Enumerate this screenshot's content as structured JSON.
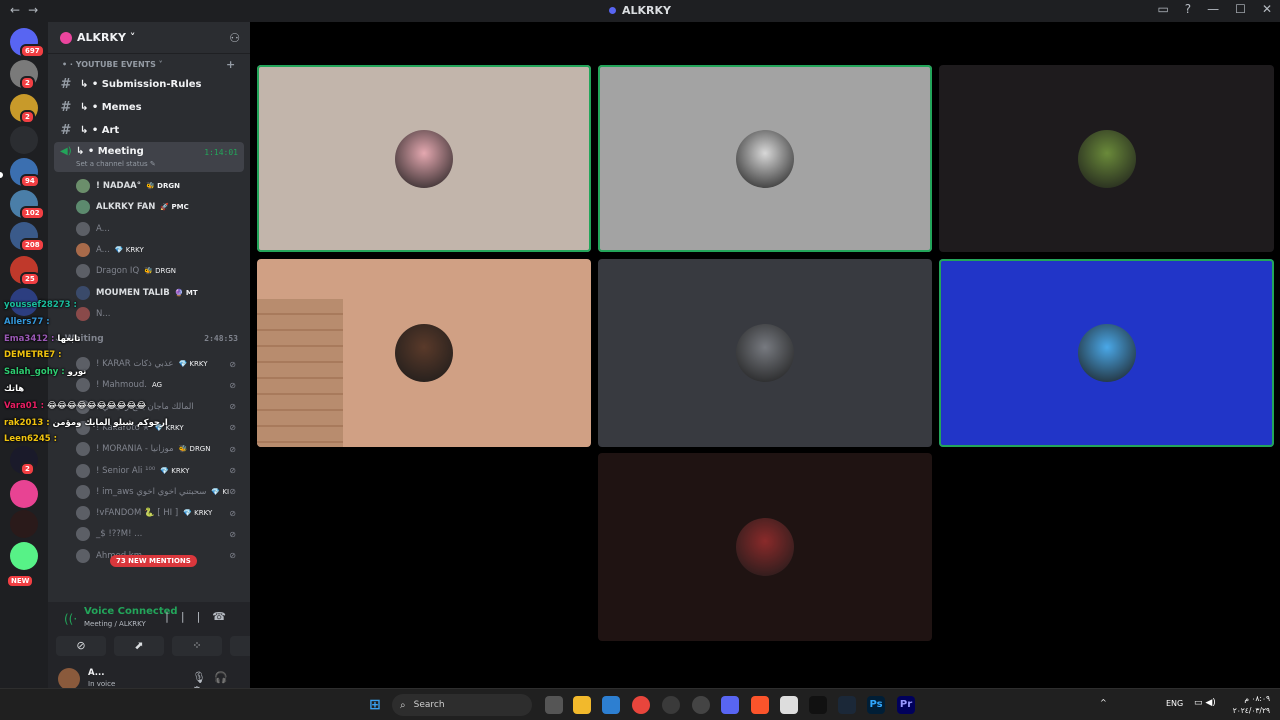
{
  "window": {
    "title": "ALKRKY",
    "nav_back": "←",
    "nav_fwd": "→",
    "controls": [
      "▭",
      "?",
      "—",
      "☐",
      "✕"
    ]
  },
  "guilds": [
    {
      "name": "discord-home-icon",
      "badge": "697",
      "color": "#5865f2"
    },
    {
      "name": "server-1",
      "badge": "2",
      "color": "#7a7a7a"
    },
    {
      "name": "server-2",
      "badge": "2",
      "color": "#c89a2a"
    },
    {
      "name": "server-cloud",
      "badge": "",
      "color": "#2b2d31"
    },
    {
      "name": "server-3",
      "badge": "94",
      "color": "#3b6fb0"
    },
    {
      "name": "server-4",
      "badge": "102",
      "color": "#4a7ea8"
    },
    {
      "name": "server-5",
      "badge": "208",
      "color": "#3a5a8a"
    },
    {
      "name": "server-6",
      "badge": "25",
      "color": "#c0392b"
    },
    {
      "name": "server-7",
      "badge": "",
      "color": "#2c3e80"
    },
    {
      "name": "server-8",
      "badge": "2",
      "color": "#1a1a2a"
    },
    {
      "name": "server-9",
      "badge": "",
      "color": "#e84393"
    },
    {
      "name": "server-10",
      "badge": "",
      "color": "#2a1a1a"
    },
    {
      "name": "server-new",
      "badge": "NEW",
      "color": "#57f287"
    }
  ],
  "server": {
    "name": "ALKRKY ˅",
    "category": "• · YOUTUBE EVENTS ˅",
    "channels": [
      "↳ • Submission-Rules",
      "↳ • Memes",
      "↳ • Art"
    ],
    "voice_channel": {
      "name": "↳ • Meeting",
      "time": "1:14:01",
      "status": "Set a channel status ✎"
    },
    "members": [
      {
        "name": "! NADAA°",
        "tag": "🐝 DRGN",
        "dim": false
      },
      {
        "name": "ALKRKY FAN",
        "tag": "🚀 PMC",
        "dim": false
      },
      {
        "name": "A...",
        "tag": "",
        "dim": true
      },
      {
        "name": "A...",
        "tag": "💎 KRKY",
        "dim": true
      },
      {
        "name": "Dragon IQ",
        "tag": "🐝 DRGN",
        "dim": true
      },
      {
        "name": "MOUMEN TALIB",
        "tag": "🔮 MT",
        "dim": false
      },
      {
        "name": "N...",
        "tag": "",
        "dim": true
      }
    ],
    "waiting": {
      "name": "⌄ Waiting",
      "time": "2:48:53"
    },
    "waiting_members": [
      {
        "name": "! KARAR عذبي ذكات",
        "tag": "💎 KRKY"
      },
      {
        "name": "! Mahmoud.",
        "tag": "AG"
      },
      {
        "name": "! المالك ماجان يتتح زحيحتي",
        "tag": ""
      },
      {
        "name": "! Kakaroto ✭",
        "tag": "💎 KRKY"
      },
      {
        "name": "! MORANIA - موزانيا",
        "tag": "🐝 DRGN"
      },
      {
        "name": "! Senior Ali ¹⁰⁰",
        "tag": "💎 KRKY"
      },
      {
        "name": "! im_aws سحبتني اخوي اخوي",
        "tag": "💎 KI"
      },
      {
        "name": "!vFANDOM 🐍 [ HI ]",
        "tag": "💎 KRKY"
      },
      {
        "name": "_$ !??M! ...",
        "tag": ""
      },
      {
        "name": "Ahmed km",
        "tag": ""
      }
    ],
    "mentions": "73 NEW MENTIONS"
  },
  "chat_overlay": [
    {
      "user": "youssef28273 :",
      "msg": "",
      "color": "#1abc9c"
    },
    {
      "user": "Allers77 :",
      "msg": "",
      "color": "#3498db"
    },
    {
      "user": "Ema3412 :",
      "msg": "تابعها",
      "color": "#9b59b6"
    },
    {
      "user": "DEMETRE7 :",
      "msg": "",
      "color": "#f1c40f"
    },
    {
      "user": "Salah_gohy :",
      "msg": "نورو",
      "color": "#2ecc71"
    },
    {
      "user": "",
      "msg": "هاتك",
      "color": "#e91e63"
    },
    {
      "user": "Vara01 :",
      "msg": "😂😂😂😂😂😂😂😂😂😂",
      "color": "#e91e63"
    },
    {
      "user": "rak2013 :",
      "msg": "ارجوكم شيلو المايك ومؤمن",
      "color": "#f1c40f"
    },
    {
      "user": "Leen6245 :",
      "msg": "",
      "color": "#f1c40f"
    }
  ],
  "voice_panel": {
    "status": "Voice Connected",
    "location": "Meeting / ALKRKY",
    "buttons": [
      "⊘",
      "⬈",
      "⁘",
      "✺"
    ]
  },
  "user": {
    "name": "A...",
    "status": "In voice"
  },
  "tiles": [
    {
      "bg": "#c2b5ab",
      "speaking": true,
      "avatar": "#e4a8b0"
    },
    {
      "bg": "#a3a3a3",
      "speaking": true,
      "avatar": "#d8d8d8"
    },
    {
      "bg": "#1e1b1d",
      "speaking": false,
      "avatar": "#6a8a3a"
    },
    {
      "bg": "#d0a084",
      "speaking": false,
      "avatar": "#5a3a2a"
    },
    {
      "bg": "#383a40",
      "speaking": false,
      "avatar": "#777a80"
    },
    {
      "bg": "#2135c8",
      "speaking": true,
      "avatar": "#4aa8e8"
    },
    {
      "bg": "#1f1312",
      "speaking": false,
      "avatar": "#8a2a2a"
    }
  ],
  "taskbar": {
    "search": "Search",
    "tray_lang": "ENG",
    "time": "٠٨:٠٩ م",
    "date": "٢٠٢٤/٠٣/٢٩"
  }
}
